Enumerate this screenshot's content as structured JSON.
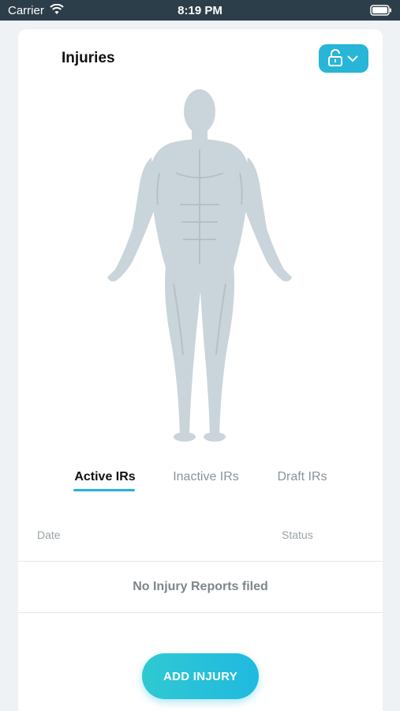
{
  "status_bar": {
    "carrier": "Carrier",
    "time": "8:19 PM",
    "wifi_icon": "wifi-icon",
    "battery_icon": "battery-icon"
  },
  "header": {
    "title": "Injuries",
    "lock_menu_icon": "unlock-icon",
    "chevron_icon": "chevron-down-icon"
  },
  "colors": {
    "accent": "#27b5d8",
    "figure": "#c9d5da",
    "text_dark": "#111111",
    "text_muted": "#8a949a"
  },
  "tabs": [
    {
      "label": "Active IRs",
      "active": true
    },
    {
      "label": "Inactive IRs",
      "active": false
    },
    {
      "label": "Draft IRs",
      "active": false
    }
  ],
  "table": {
    "columns": [
      "Date",
      "Status"
    ],
    "empty_message": "No Injury Reports filed"
  },
  "actions": {
    "add_label": "ADD INJURY"
  }
}
